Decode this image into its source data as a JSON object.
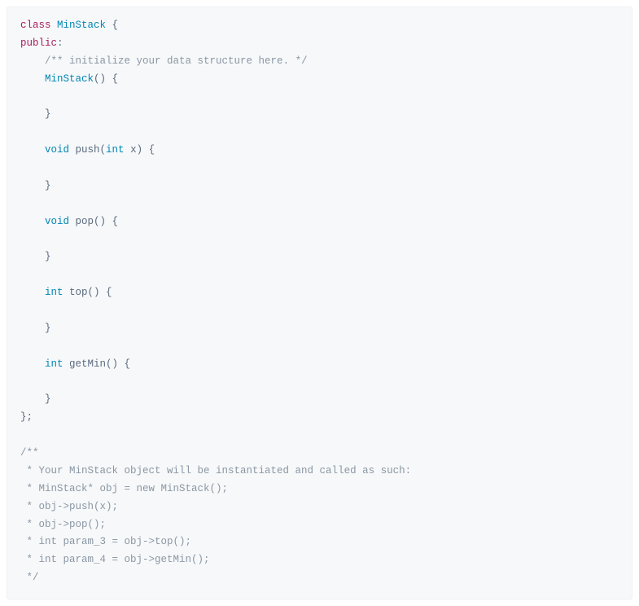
{
  "code": {
    "kw_class": "class",
    "className": "MinStack",
    "braceOpen": " {",
    "kw_public": "public",
    "colon": ":",
    "cm_init": "/** initialize your data structure here. */",
    "ctor": "MinStack",
    "ctor_after": "() {",
    "kw_void1": "void",
    "push": " push(",
    "kw_int_param": "int",
    "push_after": " x) {",
    "kw_void2": "void",
    "pop": " pop() {",
    "kw_int1": "int",
    "top": " top() {",
    "kw_int2": "int",
    "getmin": " getMin() {",
    "closeBrace": "}",
    "endBraces": "};",
    "usage1": "/**",
    "usage2": " * Your MinStack object will be instantiated and called as such:",
    "usage3": " * MinStack* obj = new MinStack();",
    "usage4": " * obj->push(x);",
    "usage5": " * obj->pop();",
    "usage6": " * int param_3 = obj->top();",
    "usage7": " * int param_4 = obj->getMin();",
    "usage8": " */"
  }
}
